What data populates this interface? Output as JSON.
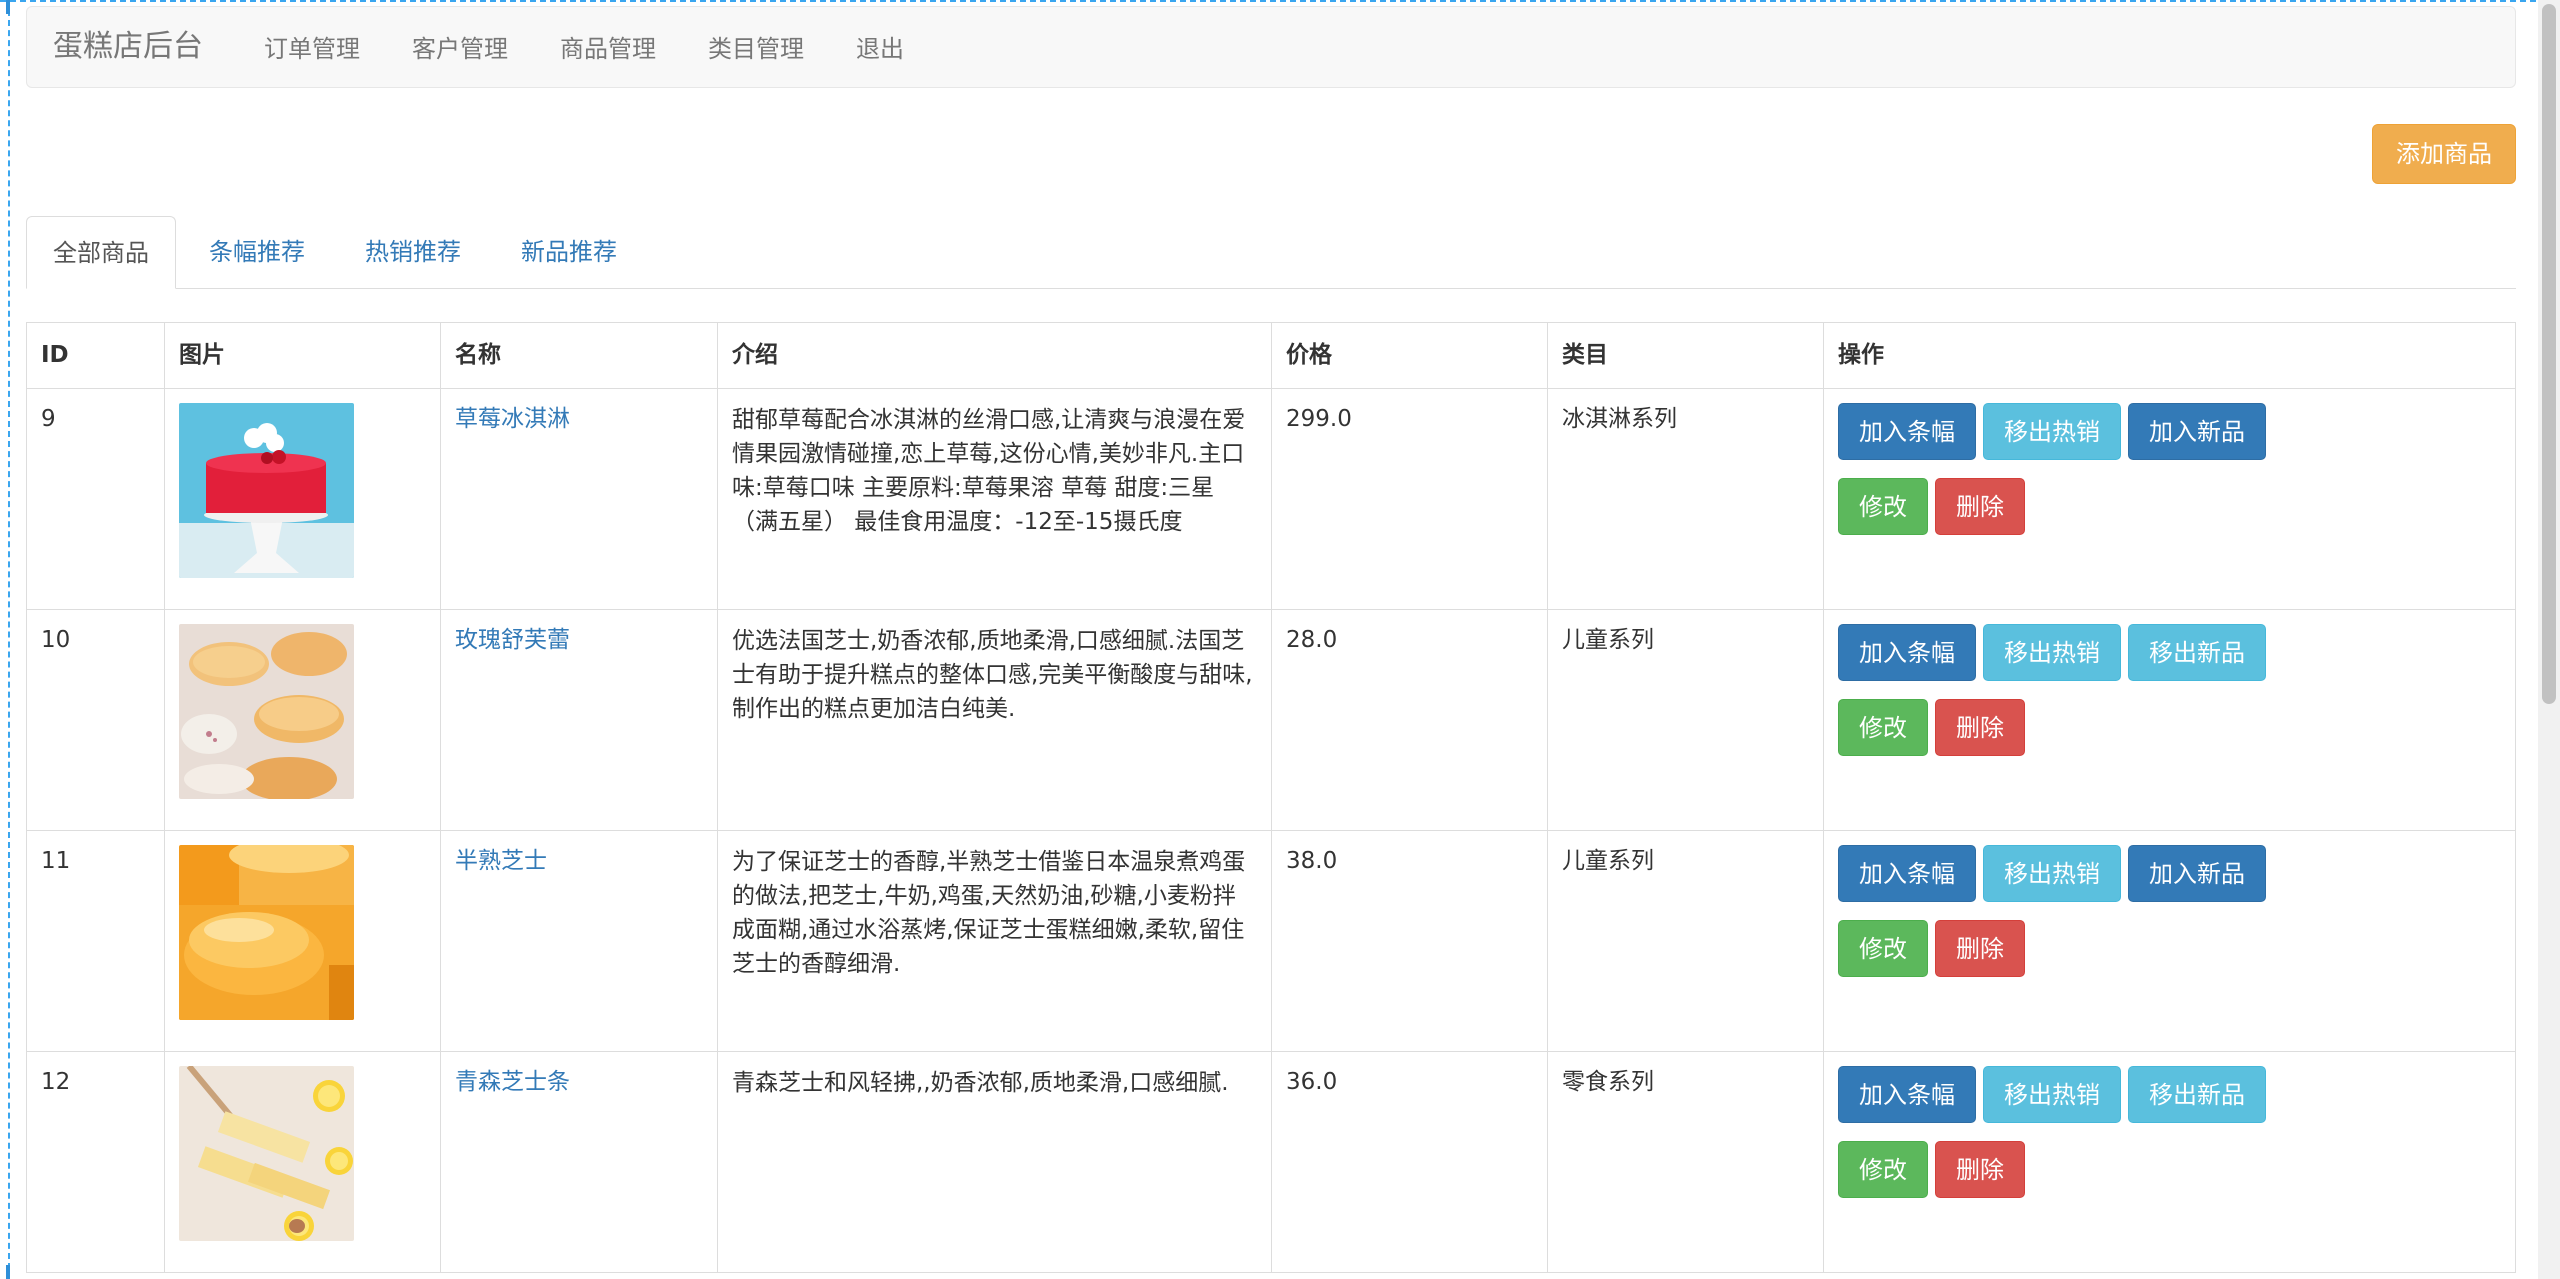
{
  "navbar": {
    "brand": "蛋糕店后台",
    "links": [
      "订单管理",
      "客户管理",
      "商品管理",
      "类目管理",
      "退出"
    ]
  },
  "toolbar": {
    "add_label": "添加商品"
  },
  "tabs": [
    "全部商品",
    "条幅推荐",
    "热销推荐",
    "新品推荐"
  ],
  "table": {
    "headers": [
      "ID",
      "图片",
      "名称",
      "介绍",
      "价格",
      "类目",
      "操作"
    ],
    "rows": [
      {
        "id": "9",
        "image": "strawberry-icecream-cake",
        "name": "草莓冰淇淋",
        "desc": "甜郁草莓配合冰淇淋的丝滑口感,让清爽与浪漫在爱情果园激情碰撞,恋上草莓,这份心情,美妙非凡.主口味:草莓口味 主要原料:草莓果溶 草莓 甜度:三星（满五星） 最佳食用温度：-12至-15摄氏度",
        "price": "299.0",
        "category": "冰淇淋系列",
        "buttons": {
          "banner": "加入条幅",
          "hot": "移出热销",
          "new": "加入新品",
          "edit": "修改",
          "delete": "删除"
        }
      },
      {
        "id": "10",
        "image": "rose-souffle",
        "name": "玫瑰舒芙蕾",
        "desc": "优选法国芝士,奶香浓郁,质地柔滑,口感细腻.法国芝士有助于提升糕点的整体口感,完美平衡酸度与甜味,制作出的糕点更加洁白纯美.",
        "price": "28.0",
        "category": "儿童系列",
        "buttons": {
          "banner": "加入条幅",
          "hot": "移出热销",
          "new": "移出新品",
          "edit": "修改",
          "delete": "删除"
        }
      },
      {
        "id": "11",
        "image": "half-baked-cheese",
        "name": "半熟芝士",
        "desc": "为了保证芝士的香醇,半熟芝士借鉴日本温泉煮鸡蛋的做法,把芝士,牛奶,鸡蛋,天然奶油,砂糖,小麦粉拌成面糊,通过水浴蒸烤,保证芝士蛋糕细嫩,柔软,留住芝士的香醇细滑.",
        "price": "38.0",
        "category": "儿童系列",
        "buttons": {
          "banner": "加入条幅",
          "hot": "移出热销",
          "new": "加入新品",
          "edit": "修改",
          "delete": "删除"
        }
      },
      {
        "id": "12",
        "image": "green-forest-cheese-bars",
        "name": "青森芝士条",
        "desc": "青森芝士和风轻拂,,奶香浓郁,质地柔滑,口感细腻.",
        "price": "36.0",
        "category": "零食系列",
        "buttons": {
          "banner": "加入条幅",
          "hot": "移出热销",
          "new": "移出新品",
          "edit": "修改",
          "delete": "删除"
        }
      }
    ]
  },
  "colors": {
    "primary": "#337ab7",
    "info": "#5bc0de",
    "success": "#5cb85c",
    "danger": "#d9534f",
    "warning": "#f0ad4e"
  }
}
